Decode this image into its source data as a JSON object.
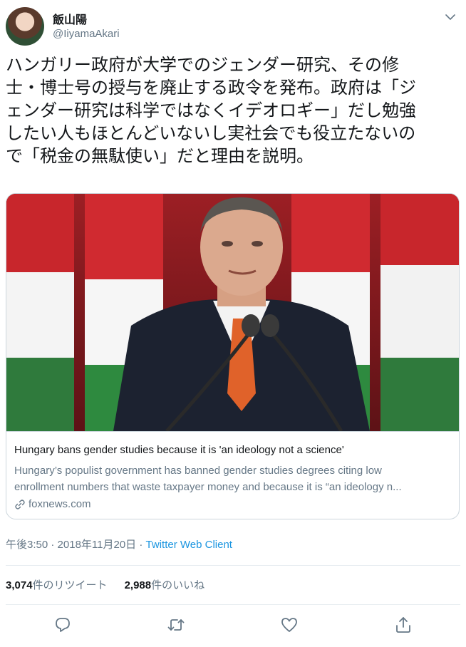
{
  "user": {
    "name": "飯山陽",
    "handle": "@IiyamaAkari"
  },
  "tweet": {
    "lines": [
      "ハンガリー政府が大学でのジェンダー研究、その修",
      "士・博士号の授与を廃止する政令を発布。政府は「ジ",
      "ェンダー研究は科学ではなくイデオロギー」だし勉強",
      "したい人もほとんどいないし実社会でも役立たないの",
      "で「税金の無駄使い」だと理由を説明。"
    ]
  },
  "card": {
    "title": "Hungary bans gender studies because it is 'an ideology not a science'",
    "description_lines": [
      "Hungary’s populist government has banned gender studies degrees citing low",
      "enrollment numbers that waste taxpayer money and because it is “an ideology n..."
    ],
    "domain": "foxnews.com"
  },
  "meta": {
    "time": "午後3:50",
    "date": "2018年11月20日",
    "sep": "·",
    "client": "Twitter Web Client"
  },
  "stats": {
    "retweets_count": "3,074",
    "retweets_label": "件のリツイート",
    "likes_count": "2,988",
    "likes_label": "件のいいね"
  },
  "colors": {
    "link": "#1b95e0",
    "secondary_text": "#657786",
    "divider": "#e6ecf0"
  },
  "icons": [
    "chevron-down-icon",
    "link-icon",
    "reply-icon",
    "retweet-icon",
    "like-icon",
    "share-icon"
  ]
}
